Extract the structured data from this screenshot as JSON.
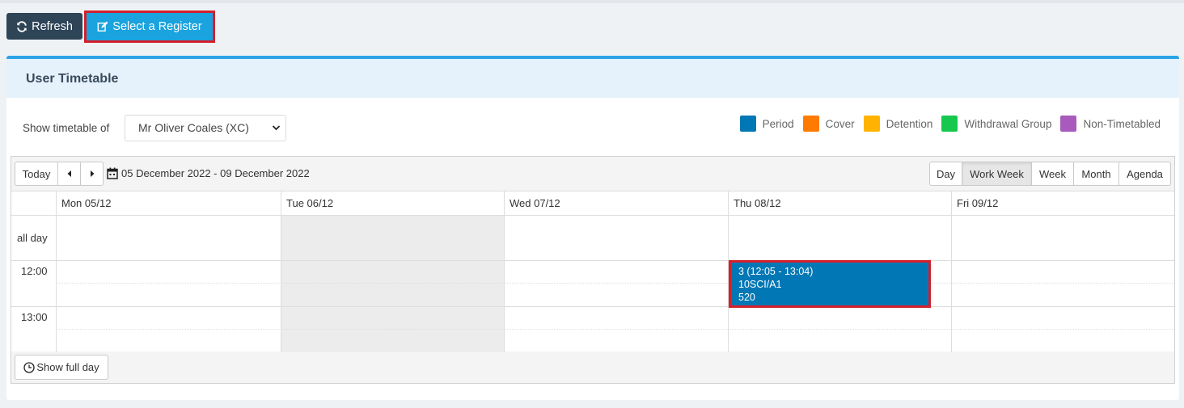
{
  "toolbar": {
    "refresh_label": "Refresh",
    "select_register_label": "Select a Register"
  },
  "panel": {
    "title": "User Timetable",
    "show_label": "Show timetable of",
    "selected_user": "Mr Oliver Coales (XC)"
  },
  "legend": [
    {
      "label": "Period",
      "color": "#0277b5"
    },
    {
      "label": "Cover",
      "color": "#ff7a00"
    },
    {
      "label": "Detention",
      "color": "#ffb300"
    },
    {
      "label": "Withdrawal Group",
      "color": "#16c94e"
    },
    {
      "label": "Non-Timetabled",
      "color": "#a95bbd"
    }
  ],
  "calendar": {
    "today_label": "Today",
    "prev_icon": "caret-left-icon",
    "next_icon": "caret-right-icon",
    "date_range": "05 December 2022 - 09 December 2022",
    "views": [
      "Day",
      "Work Week",
      "Week",
      "Month",
      "Agenda"
    ],
    "active_view": "Work Week",
    "days": [
      "Mon 05/12",
      "Tue 06/12",
      "Wed 07/12",
      "Thu 08/12",
      "Fri 09/12"
    ],
    "highlighted_day": "Tue 06/12",
    "all_day_label": "all day",
    "times": [
      "12:00",
      "13:00"
    ],
    "event": {
      "line1": "3 (12:05 - 13:04)",
      "line2": "10SCI/A1",
      "line3": "520"
    },
    "show_full_day_label": "Show full day"
  }
}
